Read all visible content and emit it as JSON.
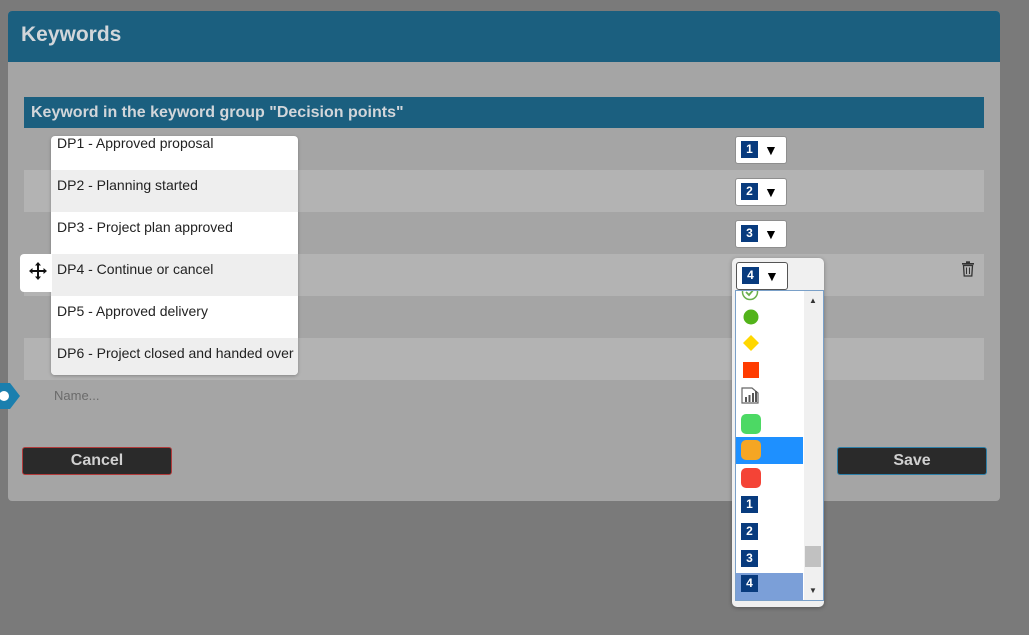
{
  "dialog": {
    "title": "Keywords",
    "group_title": "Keyword in the keyword group \"Decision points\"",
    "cancel_label": "Cancel",
    "save_label": "Save"
  },
  "keywords": [
    {
      "label": "DP1 - Approved proposal",
      "icon_number": "1"
    },
    {
      "label": "DP2 - Planning started",
      "icon_number": "2"
    },
    {
      "label": "DP3 - Project plan approved",
      "icon_number": "3"
    },
    {
      "label": "DP4 - Continue or cancel",
      "icon_number": "4"
    },
    {
      "label": "DP5 - Approved delivery",
      "icon_number": ""
    },
    {
      "label": "DP6 - Project closed and handed over",
      "icon_number": ""
    }
  ],
  "new_keyword": {
    "placeholder": "Name..."
  },
  "icon_dropdown": {
    "selected_value": "4",
    "options": [
      {
        "icon": "green-check-circle-icon",
        "color": "#6ab04c"
      },
      {
        "icon": "green-dot-icon",
        "color": "#52b31a"
      },
      {
        "icon": "yellow-diamond-icon",
        "color": "#ffd700"
      },
      {
        "icon": "orange-square-icon",
        "color": "#ff3c00"
      },
      {
        "icon": "signal-bars-icon",
        "color": "#555555"
      },
      {
        "icon": "green-rounded-square-icon",
        "color": "#4cd964"
      },
      {
        "icon": "orange-rounded-square-icon",
        "color": "#f5a623"
      },
      {
        "icon": "red-rounded-square-icon",
        "color": "#f44336"
      },
      {
        "icon": "number-1-icon",
        "label": "1"
      },
      {
        "icon": "number-2-icon",
        "label": "2"
      },
      {
        "icon": "number-3-icon",
        "label": "3"
      },
      {
        "icon": "number-4-icon",
        "label": "4"
      }
    ],
    "highlighted_option": "orange-rounded-square-icon",
    "current_option": "number-4-icon"
  },
  "colors": {
    "header": "#1b5f7f",
    "overlay": "#a5a5a5",
    "number_icon": "#083b7e",
    "selection": "#1e90ff"
  }
}
